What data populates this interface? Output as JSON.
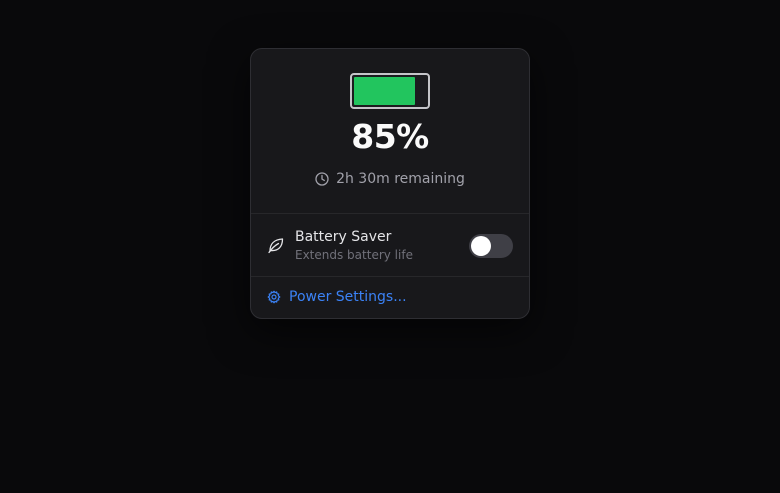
{
  "battery": {
    "level_fraction": 0.85,
    "percent_text": "85%",
    "remaining_text": "2h 30m remaining",
    "fill_color": "#22c55e"
  },
  "battery_saver": {
    "title": "Battery Saver",
    "subtitle": "Extends battery life",
    "enabled": false
  },
  "power_settings": {
    "label": "Power Settings...",
    "color": "#3b82f6"
  }
}
